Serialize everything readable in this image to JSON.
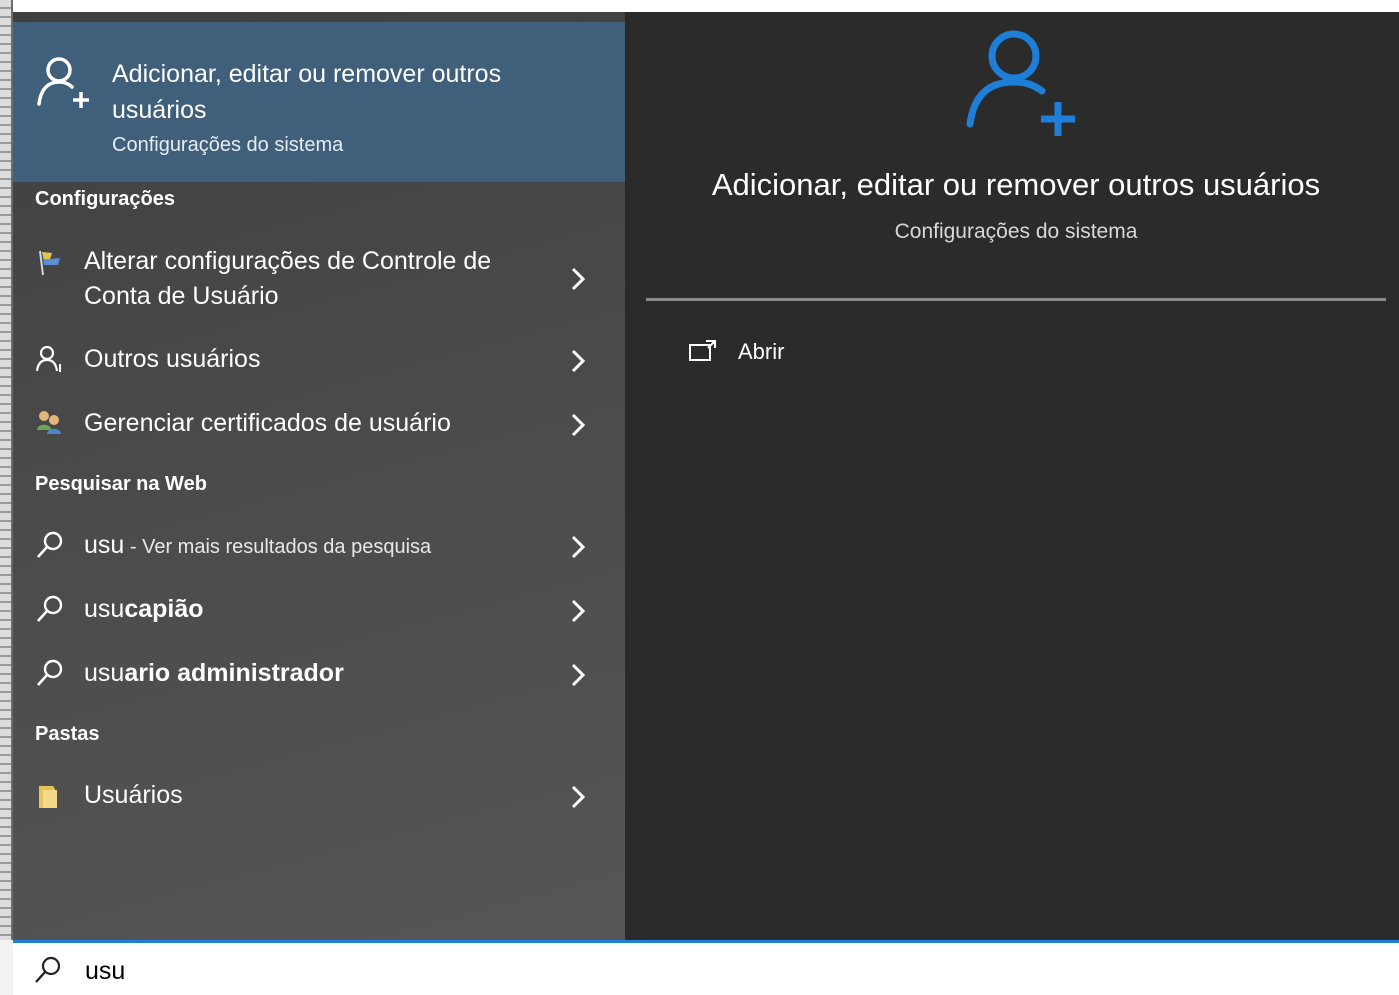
{
  "top_result": {
    "title": "Adicionar, editar ou remover outros usuários",
    "subtitle": "Configurações do sistema",
    "icon": "user-add-icon"
  },
  "sections": {
    "settings": "Configurações",
    "web": "Pesquisar na Web",
    "folders": "Pastas"
  },
  "settings_items": [
    {
      "label": "Alterar configurações de Controle de Conta de Usuário",
      "icon": "uac-flag-icon"
    },
    {
      "label": "Outros usuários",
      "icon": "user-icon"
    },
    {
      "label": "Gerenciar certificados de usuário",
      "icon": "certificates-icon"
    }
  ],
  "web_items": [
    {
      "prefix": "usu",
      "suffix": " - Ver mais resultados da pesquisa",
      "icon": "search-icon"
    },
    {
      "prefix": "usu",
      "suffix": "capião",
      "icon": "search-icon"
    },
    {
      "prefix": "usu",
      "suffix": "ario administrador",
      "icon": "search-icon"
    }
  ],
  "folder_items": [
    {
      "label": "Usuários",
      "icon": "folder-icon"
    }
  ],
  "preview": {
    "title": "Adicionar, editar ou remover outros usuários",
    "subtitle": "Configurações do sistema",
    "action_open": "Abrir",
    "icon": "user-add-icon"
  },
  "search": {
    "value": "usu",
    "icon": "search-icon"
  },
  "colors": {
    "accent": "#1e7fd8",
    "selected_bg": "#3f5f7a",
    "panel_bg": "#2b2b2b"
  }
}
